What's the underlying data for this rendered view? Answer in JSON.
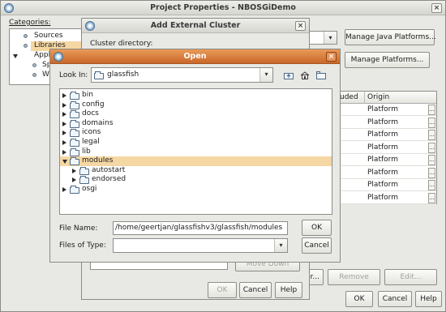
{
  "project_properties": {
    "title": "Project Properties - NBOSGiDemo",
    "close_glyph": "×",
    "categories_label": "Categories:",
    "categories": [
      {
        "label": "Sources",
        "expanded": null
      },
      {
        "label": "Libraries",
        "selected": true
      },
      {
        "label": "Appl",
        "expanded": true
      },
      {
        "label": "Sp"
      },
      {
        "label": "Wi"
      }
    ],
    "manage_java_platforms": "Manage Java Platforms...",
    "manage_platforms": "Manage Platforms...",
    "table_headers": {
      "included": "uded",
      "origin": "Origin"
    },
    "origin_rows": [
      "Platform",
      "Platform",
      "Platform",
      "Platform",
      "Platform",
      "Platform",
      "Platform",
      "Platform"
    ],
    "cell_button_glyph": "...",
    "side_button_partial": "er...",
    "remove": "Remove",
    "edit": "Edit...",
    "ok": "OK",
    "cancel": "Cancel",
    "help": "Help"
  },
  "add_cluster": {
    "title": "Add External Cluster",
    "close_glyph": "×",
    "cluster_directory_label": "Cluster directory:",
    "move_down": "Move Down",
    "ok": "OK",
    "cancel": "Cancel",
    "help": "Help"
  },
  "open_dialog": {
    "title": "Open",
    "close_glyph": "×",
    "look_in_label": "Look In:",
    "look_in_value": "glassfish",
    "dropdown_glyph": "▾",
    "tree": [
      {
        "label": "bin",
        "level": 0,
        "state": "collapsed"
      },
      {
        "label": "config",
        "level": 0,
        "state": "collapsed"
      },
      {
        "label": "docs",
        "level": 0,
        "state": "collapsed"
      },
      {
        "label": "domains",
        "level": 0,
        "state": "collapsed"
      },
      {
        "label": "icons",
        "level": 0,
        "state": "collapsed"
      },
      {
        "label": "legal",
        "level": 0,
        "state": "collapsed"
      },
      {
        "label": "lib",
        "level": 0,
        "state": "collapsed"
      },
      {
        "label": "modules",
        "level": 0,
        "state": "expanded",
        "selected": true
      },
      {
        "label": "autostart",
        "level": 1,
        "state": "collapsed"
      },
      {
        "label": "endorsed",
        "level": 1,
        "state": "collapsed"
      },
      {
        "label": "osgi",
        "level": 0,
        "state": "collapsed"
      }
    ],
    "file_name_label": "File Name:",
    "file_name_value": "/home/geertjan/glassfishv3/glassfish/modules",
    "files_of_type_label": "Files of Type:",
    "files_of_type_value": "",
    "ok": "OK",
    "cancel": "Cancel",
    "icons": [
      "up-folder-icon",
      "home-icon",
      "new-folder-icon"
    ]
  },
  "colors": {
    "selection": "#f5d7a3",
    "open_titlebar": "#d67a38",
    "window_bg": "#e8e8e4"
  }
}
